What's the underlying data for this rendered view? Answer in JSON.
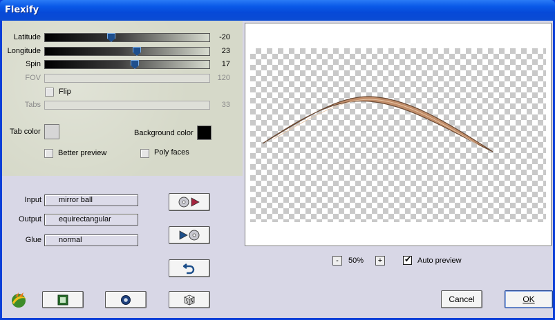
{
  "window": {
    "title": "Flexify"
  },
  "params": {
    "latitude": {
      "label": "Latitude",
      "value": "-20",
      "fraction": 0.4
    },
    "longitude": {
      "label": "Longitude",
      "value": "23",
      "fraction": 0.56
    },
    "spin": {
      "label": "Spin",
      "value": "17",
      "fraction": 0.55
    },
    "fov": {
      "label": "FOV",
      "value": "120"
    },
    "flip": {
      "label": "Flip",
      "checked": false
    },
    "tabs": {
      "label": "Tabs",
      "value": "33"
    }
  },
  "colors": {
    "tab_color_label": "Tab color",
    "tab_color": "#d6d6d6",
    "background_color_label": "Background color",
    "background_color": "#000000"
  },
  "options": {
    "better_preview": {
      "label": "Better preview",
      "checked": false
    },
    "poly_faces": {
      "label": "Poly faces",
      "checked": false
    }
  },
  "mapping": {
    "input_label": "Input",
    "input_value": "mirror ball",
    "output_label": "Output",
    "output_value": "equirectangular",
    "glue_label": "Glue",
    "glue_value": "normal"
  },
  "zoom": {
    "minus": "-",
    "level": "50%",
    "plus": "+"
  },
  "auto_preview": {
    "label": "Auto preview",
    "checked": true
  },
  "buttons": {
    "cancel": "Cancel",
    "ok": "OK"
  },
  "icons": {
    "app": "flexify-logo-icon",
    "to_input": "disc-play-icon",
    "to_output": "play-disc-icon",
    "reset": "undo-arrow-icon",
    "square": "green-square-icon",
    "circle": "blue-circle-icon",
    "random": "dice-icon"
  }
}
